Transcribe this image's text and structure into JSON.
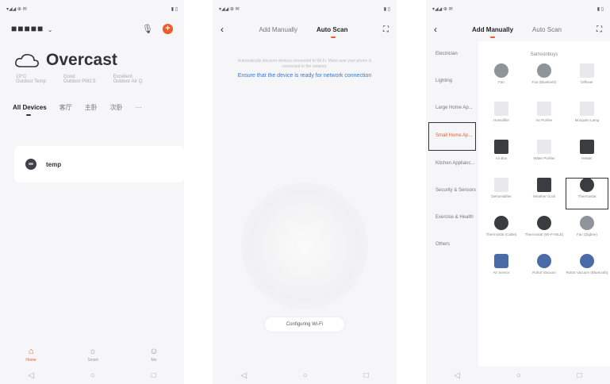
{
  "screen1": {
    "home_name": "■■■■■",
    "weather_title": "Overcast",
    "metrics": [
      {
        "value": "19°C",
        "label": "Outdoor Temp"
      },
      {
        "value": "Good",
        "label": "Outdoor PM2.5"
      },
      {
        "value": "Excellent",
        "label": "Outdoor Air Q."
      }
    ],
    "tabs": [
      "All Devices",
      "客厅",
      "主卧",
      "次卧"
    ],
    "device_name": "temp",
    "bottom_tabs": [
      "Home",
      "Smart",
      "Me"
    ]
  },
  "screen2": {
    "tab_manual": "Add Manually",
    "tab_auto": "Auto Scan",
    "scan_note": "Automatically discover devices connected to Wi-Fi. Make sure your phone is connected to the network.",
    "ensure_link": "Ensure that the device is ready for network connection",
    "config_button": "Configuring Wi-Fi"
  },
  "screen3": {
    "tab_manual": "Add Manually",
    "tab_auto": "Auto Scan",
    "categories": [
      "Electrician",
      "Lighting",
      "Large Home Ap...",
      "Small Home Ap...",
      "Kitchen Applianc...",
      "Security & Sensors",
      "Exercise & Health",
      "Others"
    ],
    "section_title": "Samsonbuys",
    "items": [
      "Fan",
      "Fan (Bluetooth)",
      "Diffuser",
      "Humidifier",
      "Air Purifier",
      "Mosquito Lamp",
      "Air Box",
      "Water Purifier",
      "Heater",
      "Dehumidifier",
      "Weather clock",
      "Thermostat",
      "Thermostat (Cable)",
      "Thermostat (Wi-Fi+BLE)",
      "Fan (Zigbee)",
      "Air Sensor",
      "Robot Vacuum",
      "Robot Vacuum (Bluetooth)"
    ]
  }
}
